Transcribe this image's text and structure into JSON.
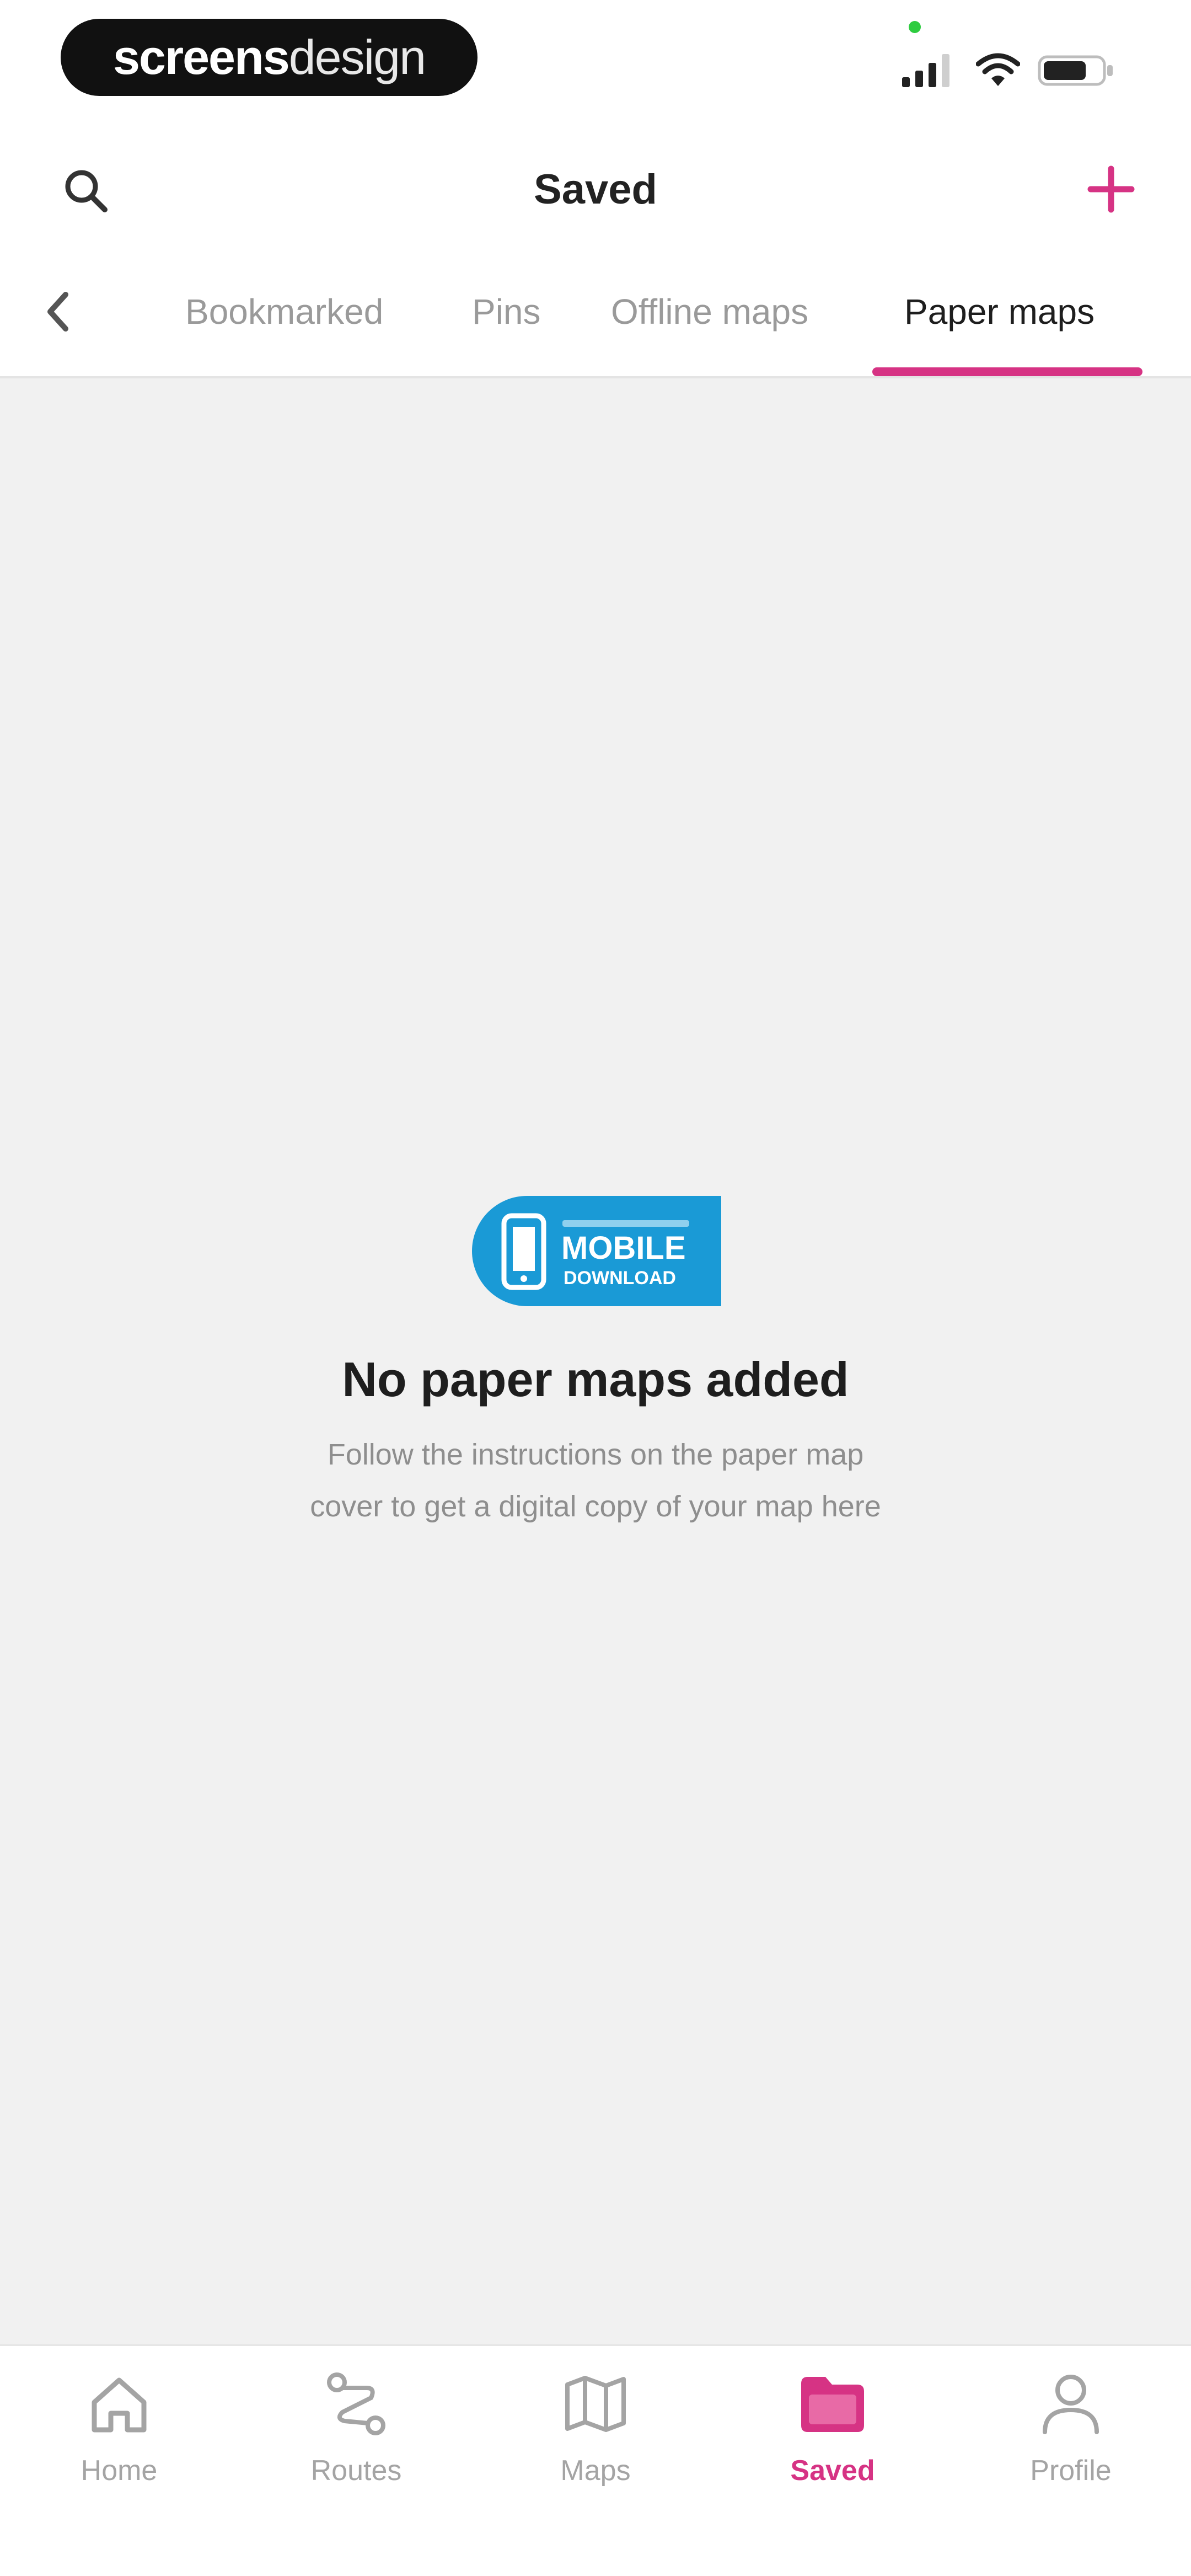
{
  "status_bar": {
    "brand_bold": "screens",
    "brand_light": "design"
  },
  "header": {
    "title": "Saved",
    "search_icon": "search-icon",
    "add_icon": "plus-icon"
  },
  "tabs": {
    "items": [
      {
        "label": "Bookmarked",
        "active": false
      },
      {
        "label": "Pins",
        "active": false
      },
      {
        "label": "Offline maps",
        "active": false
      },
      {
        "label": "Paper maps",
        "active": true
      }
    ]
  },
  "empty_state": {
    "badge_line1": "MOBILE",
    "badge_line2": "DOWNLOAD",
    "title": "No paper maps added",
    "description_line1": "Follow the instructions on the paper map",
    "description_line2": "cover to get a digital copy of your map here"
  },
  "bottom_nav": {
    "items": [
      {
        "label": "Home",
        "icon": "home-icon",
        "active": false
      },
      {
        "label": "Routes",
        "icon": "route-icon",
        "active": false
      },
      {
        "label": "Maps",
        "icon": "map-icon",
        "active": false
      },
      {
        "label": "Saved",
        "icon": "folder-icon",
        "active": true
      },
      {
        "label": "Profile",
        "icon": "profile-icon",
        "active": false
      }
    ]
  },
  "colors": {
    "accent": "#d63384",
    "badge_blue": "#1a9ad6",
    "background": "#f1f1f1",
    "inactive": "#a4a4a4"
  }
}
